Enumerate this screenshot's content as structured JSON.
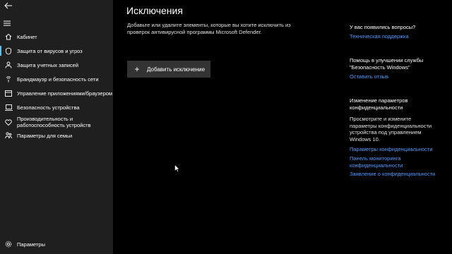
{
  "sidebar": {
    "items": [
      {
        "icon": "home-icon",
        "label": "Кабинет"
      },
      {
        "icon": "shield-icon",
        "label": "Защита от вирусов и угроз"
      },
      {
        "icon": "person-icon",
        "label": "Защита учетных записей"
      },
      {
        "icon": "wifi-icon",
        "label": "Брандмауэр и безопасность сети"
      },
      {
        "icon": "app-browser-icon",
        "label": "Управление приложениями/браузером"
      },
      {
        "icon": "laptop-icon",
        "label": "Безопасность устройства"
      },
      {
        "icon": "heart-icon",
        "label": "Производительность и работоспособность устройств"
      },
      {
        "icon": "family-icon",
        "label": "Параметры для семьи"
      }
    ],
    "settings_label": "Параметры"
  },
  "main": {
    "title": "Исключения",
    "description": "Добавьте или удалите элементы, которые вы хотите исключить из проверок антивирусной программы Microsoft Defender.",
    "add_button_label": "Добавить исключение"
  },
  "aside": {
    "questions_heading": "У вас появились вопросы?",
    "support_link": "Техническая поддержка",
    "improve_heading": "Помощь в улучшении службы \"Безопасность Windows\"",
    "feedback_link": "Оставить отзыв",
    "privacy_heading": "Изменение параметров конфиденциальности",
    "privacy_text": "Просмотрите и измените параметры конфиденциальности устройства под управлением Windows 10.",
    "privacy_settings_link": "Параметры конфиденциальности",
    "privacy_dashboard_link": "Панель мониторинга конфиденциальности",
    "privacy_statement_link": "Заявление о конфиденциальности"
  },
  "colors": {
    "accent": "#4cc2ff",
    "link": "#4c9aff",
    "sidebar_bg": "#1f1f1f",
    "button_bg": "#333333"
  }
}
